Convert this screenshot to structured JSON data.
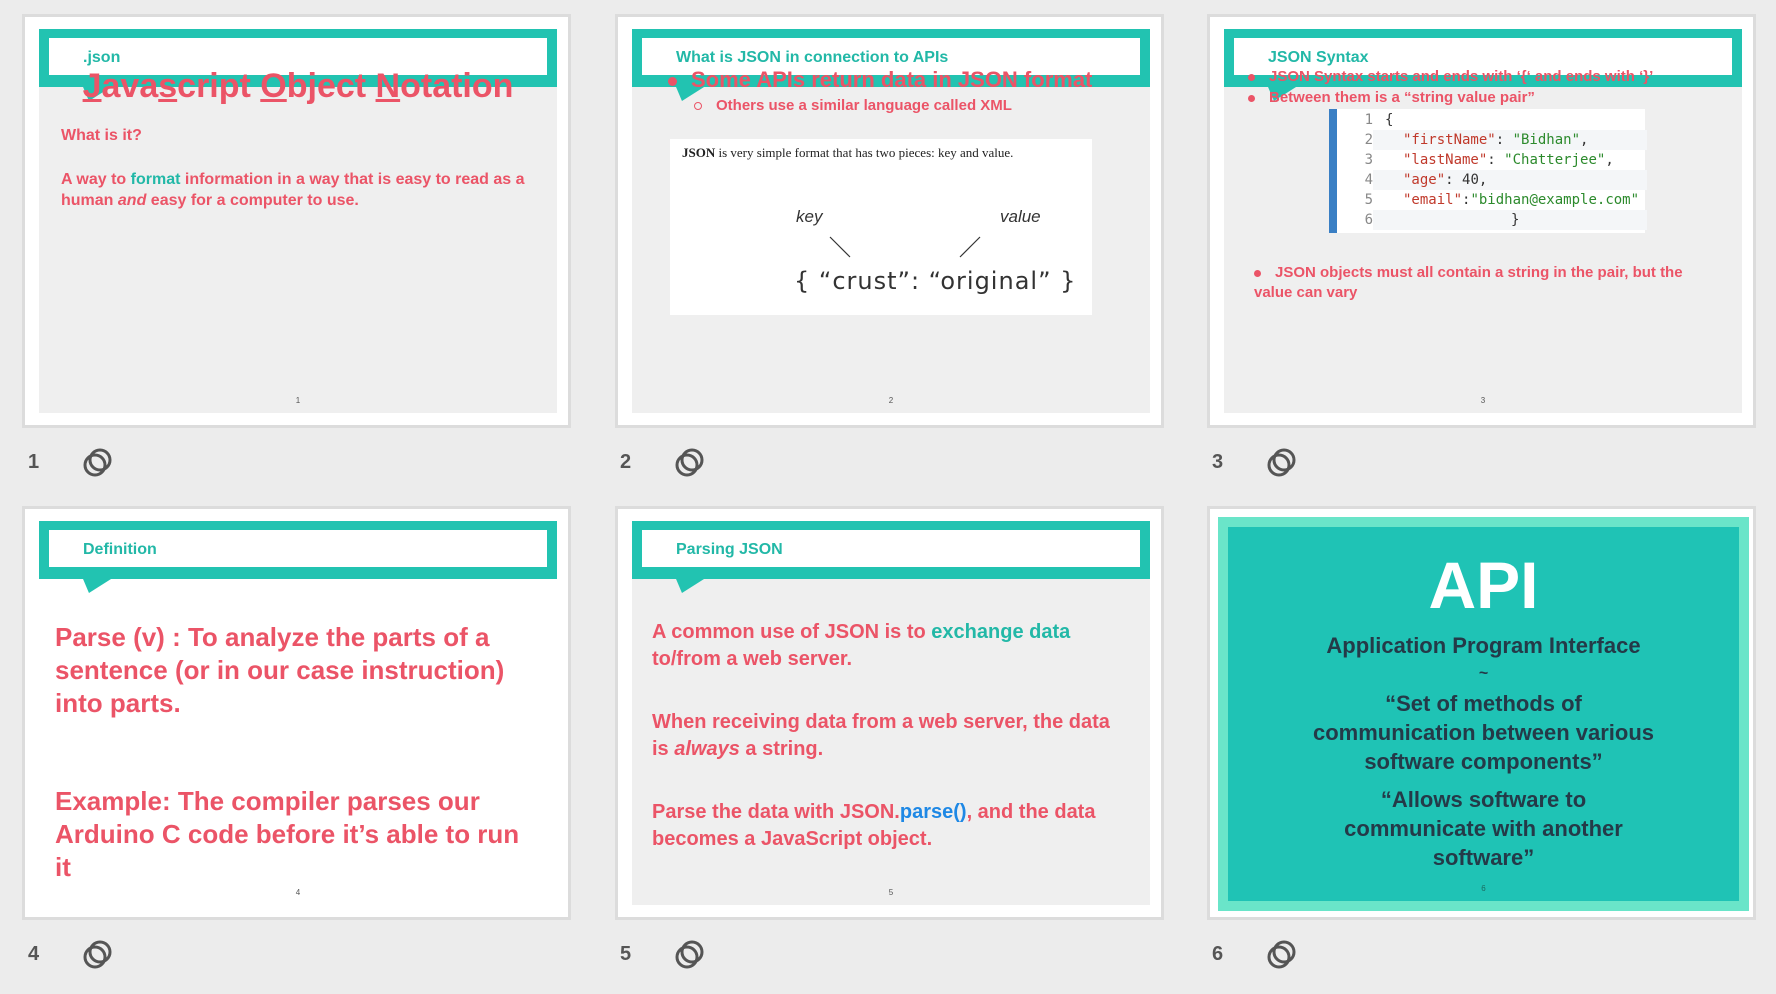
{
  "slides": [
    {
      "number": "1",
      "banner": ".json",
      "title_parts": [
        "J",
        "ava",
        "s",
        "cript ",
        "O",
        "bject ",
        "N",
        "otation"
      ],
      "question": "What is it?",
      "answer_pre": "A way to ",
      "answer_hl": "format",
      "answer_mid": " information in a way that is easy to read as a human ",
      "answer_it": "and",
      "answer_post": " easy for a computer to use.",
      "page": "1"
    },
    {
      "number": "2",
      "banner": "What is JSON in connection to APIs",
      "bullet1": "Some APIs return data in JSON format",
      "bullet2": "Others use a similar language called XML",
      "img_caption_bold": "JSON",
      "img_caption_rest": " is very simple format that has two pieces: key and value.",
      "img_key": "key",
      "img_value": "value",
      "img_code": "{ “crust”: “original” }",
      "page": "2"
    },
    {
      "number": "3",
      "banner": "JSON Syntax",
      "bullet1": "JSON Syntax starts and ends with ‘{‘ and ends with ‘}’",
      "bullet2": "Between them is a “string value pair”",
      "code_lines": [
        "1",
        "2",
        "3",
        "4",
        "5",
        "6"
      ],
      "code_l1": "{",
      "code_k2": "\"firstName\"",
      "code_v2": "\"Bidhan\"",
      "code_k3": "\"lastName\"",
      "code_v3": "\"Chatterjee\"",
      "code_k4": "\"age\"",
      "code_v4": "40",
      "code_k5": "\"email\"",
      "code_v5": "\"bidhan@example.com\"",
      "code_l6": "}",
      "bullet3": "JSON objects must all contain a string in the pair, but the value can vary",
      "page": "3"
    },
    {
      "number": "4",
      "banner": "Definition",
      "p1": "Parse (v) : To analyze the parts of a sentence (or in our case instruction) into parts.",
      "p2": "Example: The compiler parses our Arduino C code before it’s able to run it",
      "page": "4"
    },
    {
      "number": "5",
      "banner": "Parsing JSON",
      "p1_pre": "A common use of JSON is to ",
      "p1_hl": "exchange data",
      "p1_post": " to/from a web server.",
      "p2_pre": "When receiving data from a web server, the data is ",
      "p2_it": "always",
      "p2_post": " a string.",
      "p3_pre": "Parse the data with JSON.",
      "p3_hl": "parse()",
      "p3_post": ", and the data becomes a JavaScript object.",
      "page": "5"
    },
    {
      "number": "6",
      "title": "API",
      "line1": "Application Program Interface",
      "line2": "~",
      "line3": "“Set of methods of communication between various software components”",
      "line4": "“Allows software to communicate with another software”",
      "page": "6"
    }
  ],
  "colors": {
    "teal": "#22c3b1",
    "coral": "#eb5467",
    "api_bg": "#1fc3b5",
    "api_border": "#6ae5c9"
  },
  "icons": {
    "slide_action": "link-rings-icon"
  }
}
